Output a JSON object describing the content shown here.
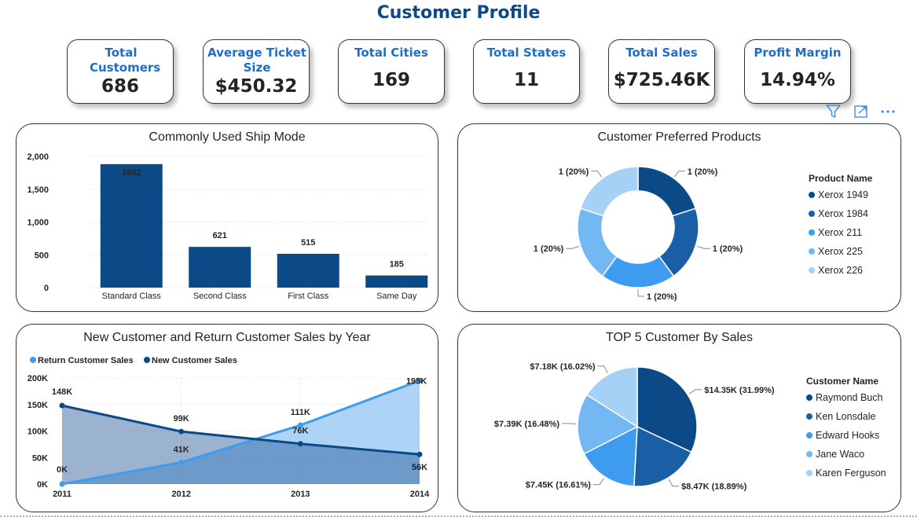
{
  "header": {
    "title": "Customer Profile"
  },
  "kpis": [
    {
      "label": "Total Customers",
      "value": "686"
    },
    {
      "label": "Average Ticket Size",
      "value": "$450.32"
    },
    {
      "label": "Total Cities",
      "value": "169"
    },
    {
      "label": "Total States",
      "value": "11"
    },
    {
      "label": "Total Sales",
      "value": "$725.46K"
    },
    {
      "label": "Profit Margin",
      "value": "14.94%"
    }
  ],
  "toolbar": {
    "icons": [
      "filter-icon",
      "focus-mode-icon",
      "more-options-icon"
    ]
  },
  "colors": {
    "navy": "#0b4a86",
    "dark": "#1a5ea6",
    "mid": "#3d9cf0",
    "light": "#74b8f3",
    "pale": "#a6d1f7",
    "accent": "#1e6ec7"
  },
  "chart_data": [
    {
      "type": "bar",
      "title": "Commonly Used Ship Mode",
      "categories": [
        "Standard Class",
        "Second Class",
        "First Class",
        "Same Day"
      ],
      "values": [
        1882,
        621,
        515,
        185
      ],
      "value_labels": [
        "1882",
        "621",
        "515",
        "185"
      ],
      "ylim": [
        0,
        2000
      ],
      "yticks": [
        "0",
        "500",
        "1,000",
        "1,500",
        "2,000"
      ],
      "ytick_values": [
        0,
        500,
        1000,
        1500,
        2000
      ],
      "grid": true
    },
    {
      "type": "pie",
      "donut": true,
      "title": "Customer Preferred Products",
      "legend_title": "Product Name",
      "legend_position": "right",
      "labels": [
        "Xerox 1949",
        "Xerox 1984",
        "Xerox 211",
        "Xerox 225",
        "Xerox 226"
      ],
      "values": [
        1,
        1,
        1,
        1,
        1
      ],
      "value_labels": [
        "1 (20%)",
        "1 (20%)",
        "1 (20%)",
        "1 (20%)",
        "1 (20%)"
      ]
    },
    {
      "type": "area",
      "title": "New Customer and Return Customer Sales by Year",
      "legend_position": "top-left",
      "x": [
        "2011",
        "2012",
        "2013",
        "2014"
      ],
      "ylim": [
        0,
        200
      ],
      "yticks": [
        "0K",
        "50K",
        "100K",
        "150K",
        "200K"
      ],
      "ytick_values": [
        0,
        50,
        100,
        150,
        200
      ],
      "series": [
        {
          "name": "Return  Customer Sales",
          "values": [
            0,
            41,
            111,
            195
          ],
          "value_labels": [
            "0K",
            "41K",
            "111K",
            "195K"
          ]
        },
        {
          "name": "New Customer Sales",
          "values": [
            148,
            99,
            76,
            56
          ],
          "value_labels": [
            "148K",
            "99K",
            "76K",
            "56K"
          ]
        }
      ],
      "grid": true
    },
    {
      "type": "pie",
      "title": "TOP 5 Customer By Sales",
      "legend_title": "Customer Name",
      "legend_position": "right",
      "labels": [
        "Raymond Buch",
        "Ken Lonsdale",
        "Edward Hooks",
        "Jane Waco",
        "Karen Ferguson"
      ],
      "values": [
        31.99,
        18.89,
        16.61,
        16.48,
        16.02
      ],
      "value_labels": [
        "$14.35K (31.99%)",
        "$8.47K (18.89%)",
        "$7.45K (16.61%)",
        "$7.39K (16.48%)",
        "$7.18K (16.02%)"
      ]
    }
  ]
}
